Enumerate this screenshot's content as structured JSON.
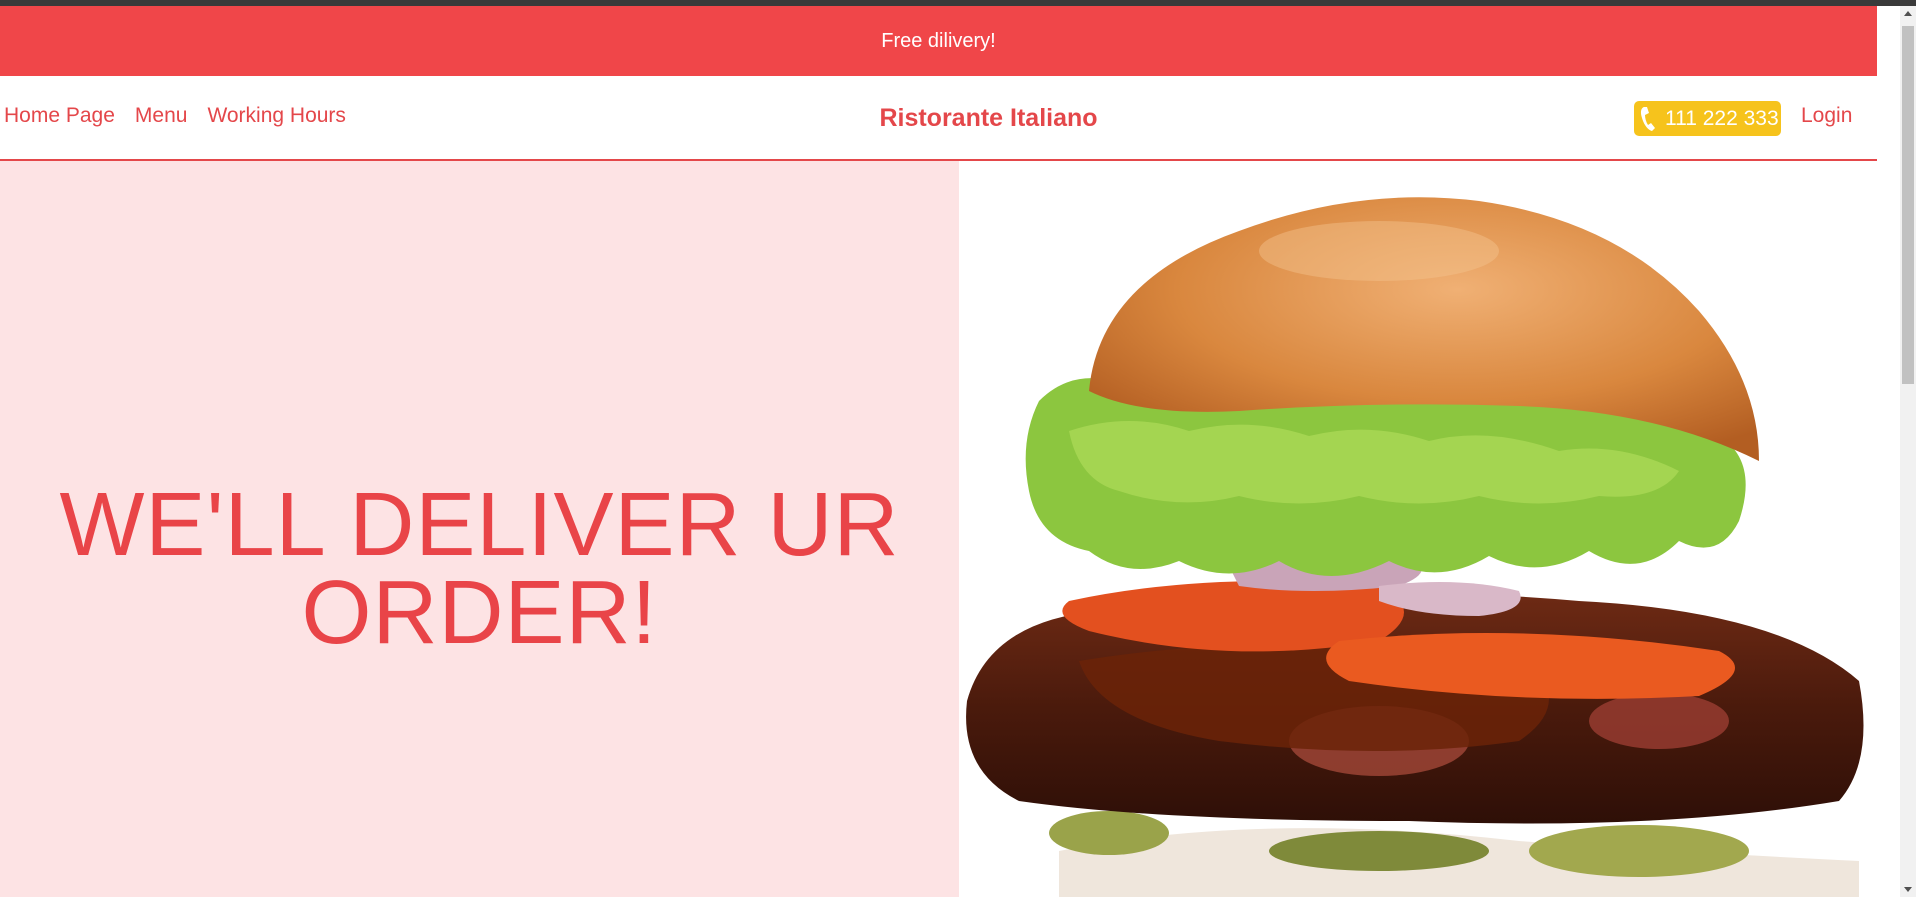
{
  "promo": {
    "text": "Free dilivery!"
  },
  "nav": {
    "links": [
      "Home Page",
      "Menu",
      "Working Hours"
    ],
    "brand": "Ristorante Italiano",
    "phone": "111 222 333",
    "login": "Login"
  },
  "hero": {
    "title": "WE'LL DELIVER UR ORDER!",
    "image": "burger-photo"
  },
  "colors": {
    "accent": "#f04649",
    "hero_bg": "#fde3e4",
    "phone_bg": "#f6c31c"
  }
}
